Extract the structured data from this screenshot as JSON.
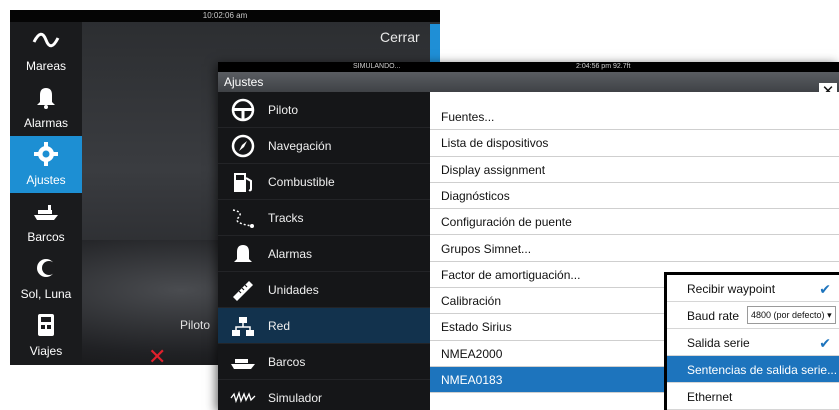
{
  "background": {
    "clock": "10:02:06 am",
    "close_label": "Cerrar",
    "rail": [
      {
        "label": "Mareas",
        "icon": "tide-wave-icon",
        "active": false
      },
      {
        "label": "Alarmas",
        "icon": "bell-icon",
        "active": false
      },
      {
        "label": "Ajustes",
        "icon": "gear-icon",
        "active": true
      },
      {
        "label": "Barcos",
        "icon": "ship-icon",
        "active": false
      },
      {
        "label": "Sol, Luna",
        "icon": "sun-moon-icon",
        "active": false
      },
      {
        "label": "Viajes",
        "icon": "trip-calculator-icon",
        "active": false
      }
    ],
    "piloto_label": "Piloto"
  },
  "dialog": {
    "status_sim": "SIMULANDO...",
    "status_time": "2:04:56 pm  92.7ft",
    "title": "Ajustes",
    "close_glyph": "✕",
    "menu": [
      {
        "label": "Piloto",
        "icon": "steering-wheel-icon"
      },
      {
        "label": "Navegación",
        "icon": "compass-icon"
      },
      {
        "label": "Combustible",
        "icon": "fuel-pump-icon"
      },
      {
        "label": "Tracks",
        "icon": "track-icon"
      },
      {
        "label": "Alarmas",
        "icon": "bell-icon"
      },
      {
        "label": "Unidades",
        "icon": "ruler-icon"
      },
      {
        "label": "Red",
        "icon": "network-icon"
      },
      {
        "label": "Barcos",
        "icon": "ship-icon"
      },
      {
        "label": "Simulador",
        "icon": "simulator-icon"
      }
    ],
    "menu_selected": 6,
    "list": [
      "Fuentes...",
      "Lista de dispositivos",
      "Display assignment",
      "Diagnósticos",
      "Configuración de puente",
      "Grupos Simnet...",
      "Factor de amortiguación...",
      "Calibración",
      "Estado Sirius",
      "NMEA2000",
      "NMEA0183"
    ],
    "list_selected": 10
  },
  "popup": {
    "receive_waypoint": "Recibir waypoint",
    "baud_rate_label": "Baud rate",
    "baud_rate_value": "4800 (por defecto)",
    "serial_output": "Salida serie",
    "serial_sentences": "Sentencias de salida serie...",
    "ethernet": "Ethernet"
  },
  "colors": {
    "accent_blue": "#1d74bd",
    "rail_active": "#1d8fd3",
    "menu_selected": "#12324d",
    "alert_red": "#e0202c"
  }
}
